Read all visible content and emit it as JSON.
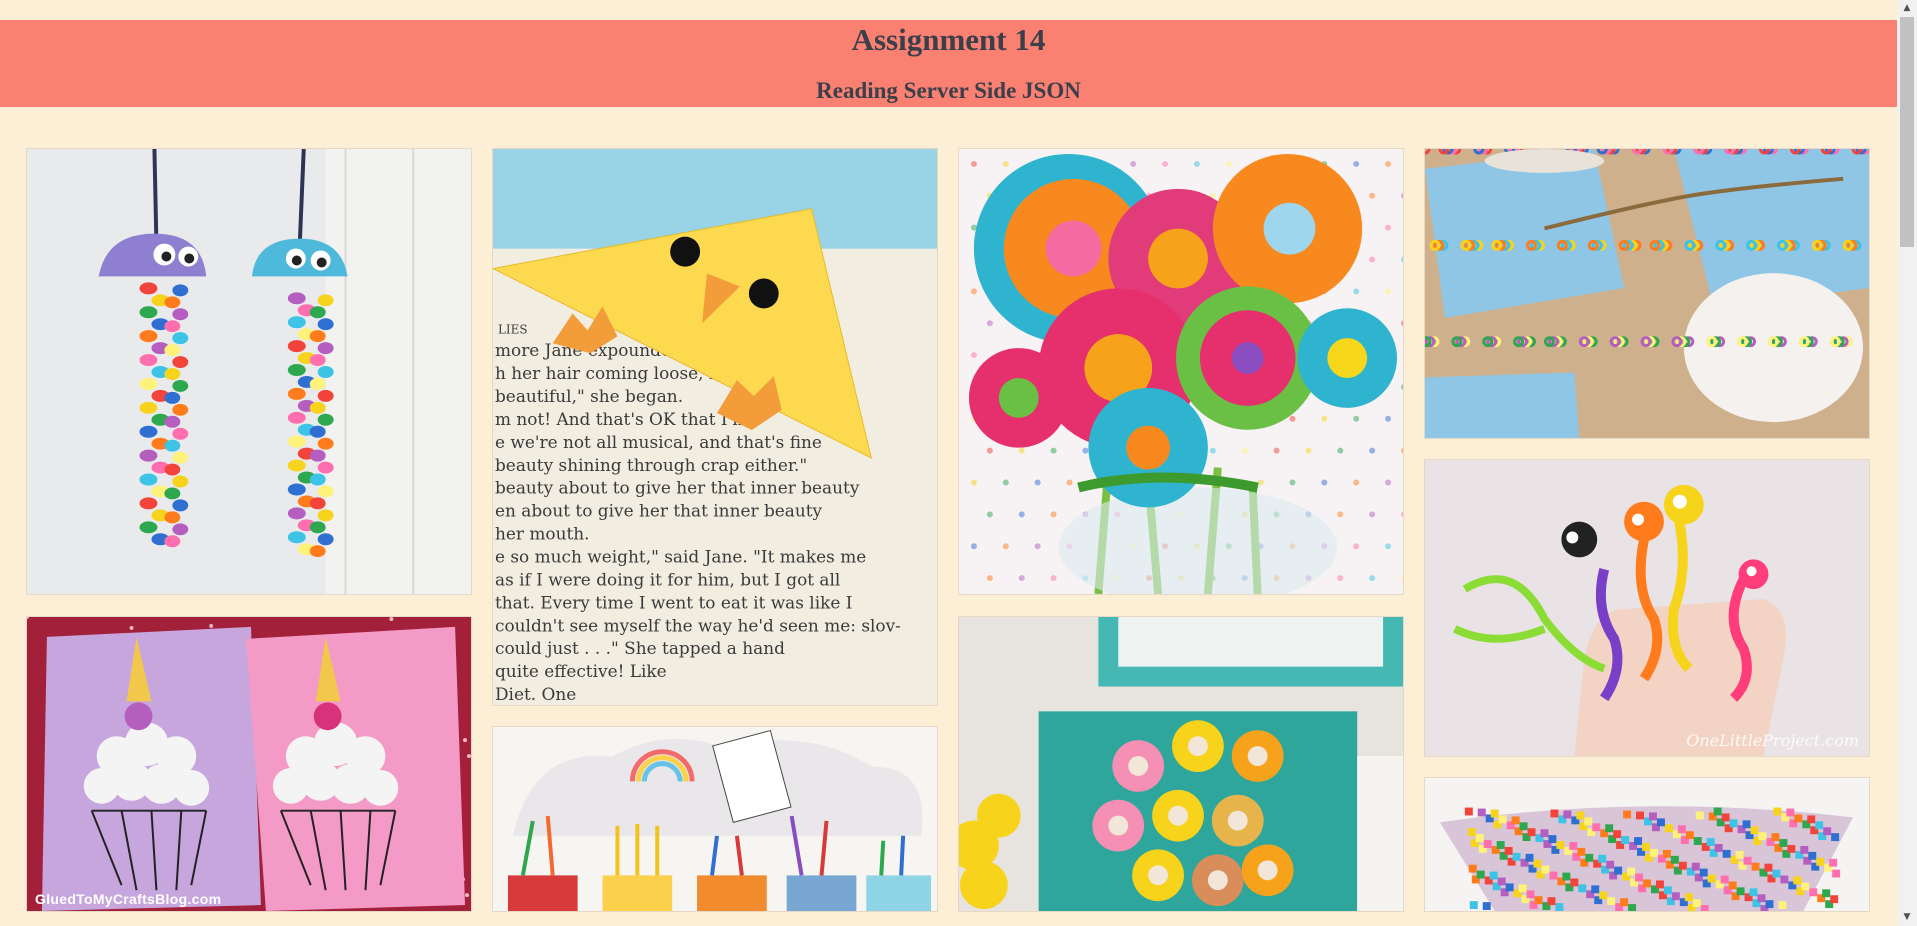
{
  "header": {
    "title": "Assignment 14",
    "subtitle": "Reading Server Side JSON"
  },
  "gallery": {
    "items": [
      {
        "subject": "egg carton jellyfish with beads"
      },
      {
        "subject": "chick corner bookmark"
      },
      {
        "subject": "felt button flower bouquet"
      },
      {
        "subject": "cereal loop necklaces"
      },
      {
        "subject": "cotton ball unicorn cupcakes",
        "watermark": "GluedToMyCraftsBlog.com"
      },
      {
        "subject": "rainbow craft supply jars"
      },
      {
        "subject": "egg carton flower canvas"
      },
      {
        "subject": "pipe cleaner finger puppets",
        "watermark": "OneLittleProject.com"
      },
      {
        "subject": "melted bead bowl"
      }
    ]
  },
  "bookmark_text": [
    "LIES",
    "more Jane expounde",
    "h her hair coming loose, her",
    "beautiful,\" she began.",
    "m not! And that's OK that I'm",
    "e we're not all musical, and that's fine",
    "beauty shining through crap either.\"",
    "beauty about to give her that inner beauty",
    "en about to give her that inner beauty",
    "her mouth.",
    "e so much weight,\" said Jane. \"It makes me",
    "as if I were doing it for him, but I got all",
    "that. Every time I went to eat it was like I",
    "couldn't see myself the way he'd seen me: slov-",
    "could just . . .\" She tapped a hand",
    "quite effective! Like",
    "Diet. One"
  ],
  "scrollbar": {
    "up": "▲",
    "down": "▼"
  }
}
